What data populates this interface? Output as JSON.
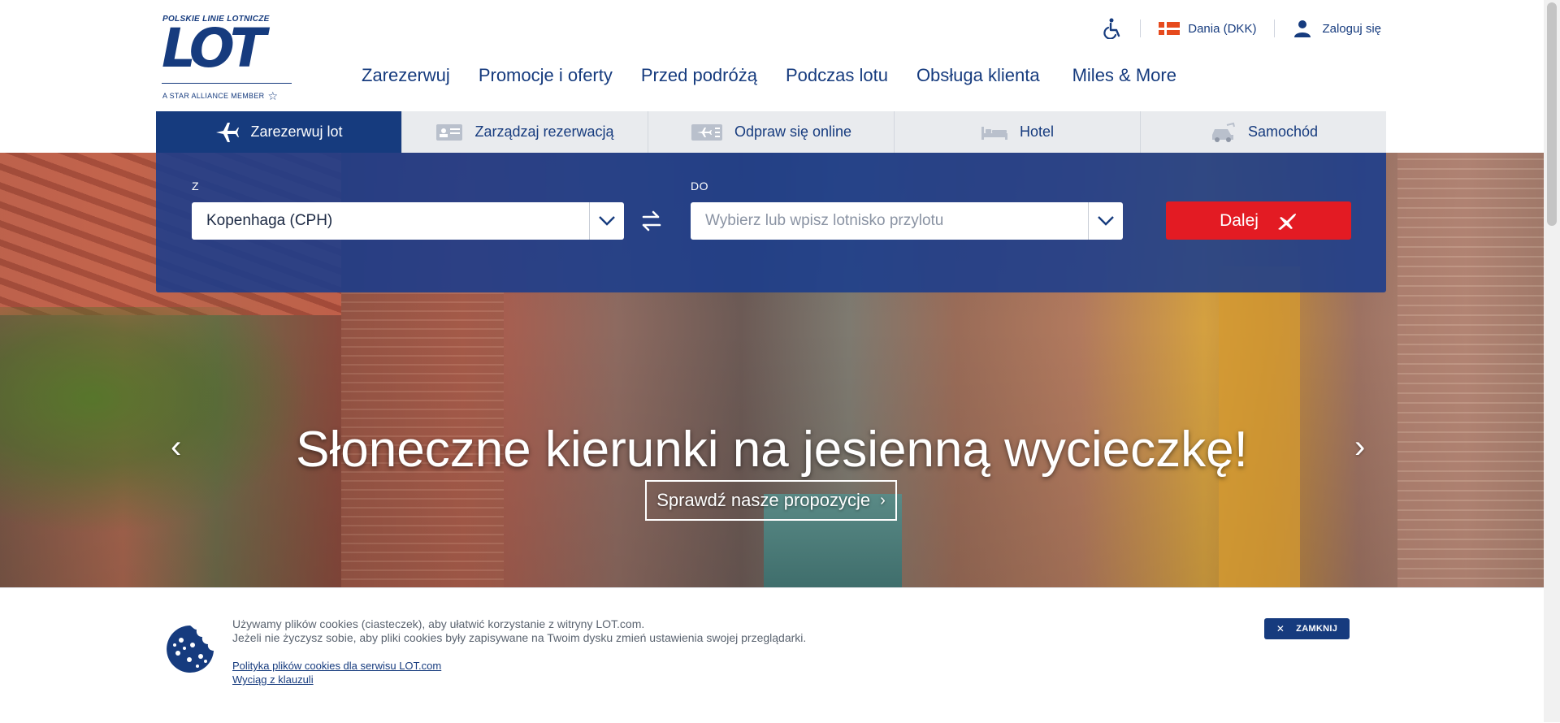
{
  "brand": {
    "tagline": "POLSKIE LINIE LOTNICZE",
    "logo_text": "LOT",
    "alliance": "A STAR ALLIANCE MEMBER"
  },
  "utilities": {
    "country": "Dania (DKK)",
    "login": "Zaloguj się"
  },
  "main_nav": [
    "Zarezerwuj",
    "Promocje i oferty",
    "Przed podróżą",
    "Podczas lotu",
    "Obsługa klienta",
    "Miles & More"
  ],
  "tabs": [
    {
      "label": "Zarezerwuj lot",
      "icon": "airplane-icon",
      "active": true
    },
    {
      "label": "Zarządzaj rezerwacją",
      "icon": "id-card-icon",
      "active": false
    },
    {
      "label": "Odpraw się online",
      "icon": "boarding-pass-icon",
      "active": false
    },
    {
      "label": "Hotel",
      "icon": "bed-icon",
      "active": false
    },
    {
      "label": "Samochód",
      "icon": "car-icon",
      "active": false
    }
  ],
  "search": {
    "from_label": "Z",
    "from_value": "Kopenhaga (CPH)",
    "to_label": "DO",
    "to_placeholder": "Wybierz lub wpisz lotnisko przylotu",
    "submit_label": "Dalej"
  },
  "hero": {
    "title": "Słoneczne kierunki na jesienną wycieczkę!",
    "cta": "Sprawdź nasze propozycje"
  },
  "cookie": {
    "line1": "Używamy plików cookies (ciasteczek), aby ułatwić korzystanie z witryny LOT.com.",
    "line2": "Jeżeli nie życzysz sobie, aby pliki cookies były zapisywane na Twoim dysku zmień ustawienia swojej przeglądarki.",
    "link1": "Polityka plików cookies dla serwisu LOT.com",
    "link2": "Wyciąg z klauzuli",
    "close_label": "ZAMKNIJ"
  },
  "colors": {
    "brand_blue": "#163b7e",
    "panel_blue": "#1a3c8c",
    "cta_red": "#e31b23",
    "tab_bg": "#e9ebee"
  }
}
